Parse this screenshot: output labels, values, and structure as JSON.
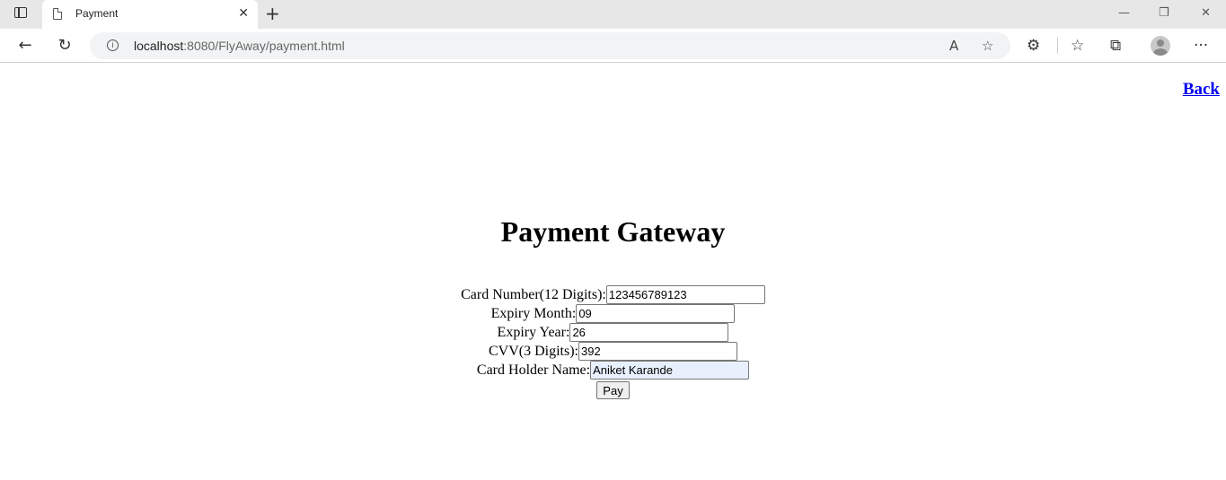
{
  "browser": {
    "tab_title": "Payment",
    "url_host": "localhost",
    "url_path": ":8080/FlyAway/payment.html",
    "icons": {
      "tab_actions": "window-icon",
      "page": "page-icon",
      "close_tab": "close-icon",
      "new_tab": "plus-icon",
      "minimize": "minimize-icon",
      "restore": "restore-icon",
      "close_window": "close-icon",
      "back": "arrow-left-icon",
      "refresh": "refresh-icon",
      "site_info": "info-icon",
      "read_aloud": "read-aloud-icon",
      "add_favorite": "star-plus-icon",
      "extensions": "puzzle-icon",
      "favorites": "favorites-icon",
      "collections": "collections-icon",
      "profile": "avatar-icon",
      "menu": "more-icon"
    }
  },
  "page": {
    "back_link": "Back",
    "title": "Payment Gateway",
    "form": {
      "card_number_label": "Card Number(12 Digits):",
      "card_number_value": "123456789123",
      "expiry_month_label": "Expiry Month:",
      "expiry_month_value": "09",
      "expiry_year_label": "Expiry Year:",
      "expiry_year_value": "26",
      "cvv_label": "CVV(3 Digits):",
      "cvv_value": "392",
      "holder_label": "Card Holder Name:",
      "holder_value": "Aniket Karande",
      "pay_button": "Pay"
    }
  }
}
